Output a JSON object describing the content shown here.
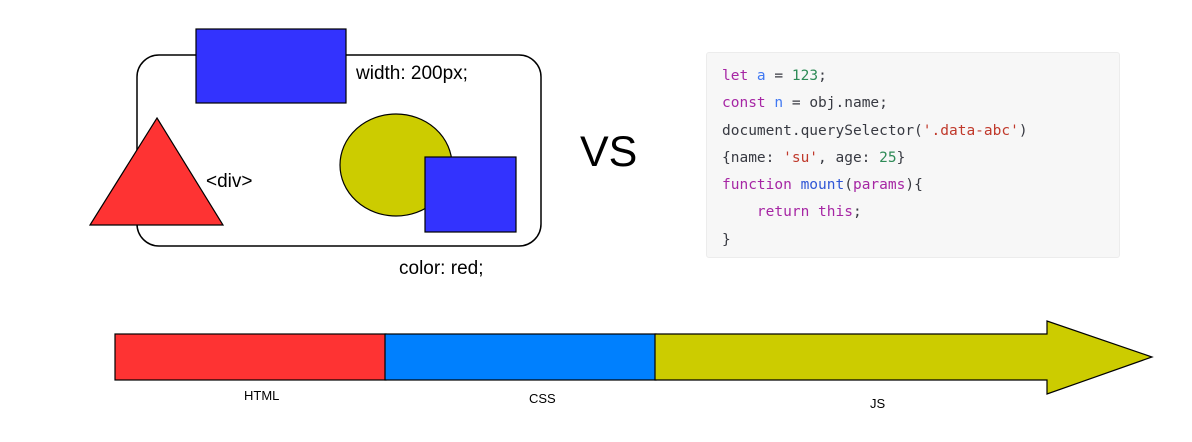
{
  "diagram": {
    "div_tag_label": "<div>",
    "width_label": "width: 200px;",
    "color_label": "color: red;",
    "versus_label": "VS",
    "colors": {
      "red": "#fe3333",
      "blue": "#3333fe",
      "olive": "#cccc00",
      "css_blue": "#0080fe",
      "outline": "#000000"
    }
  },
  "code_panel": {
    "background": "#f7f7f7",
    "lines": [
      [
        {
          "t": "let ",
          "c": "kw"
        },
        {
          "t": "a",
          "c": "var"
        },
        {
          "t": " = ",
          "c": "pl"
        },
        {
          "t": "123",
          "c": "num"
        },
        {
          "t": ";",
          "c": "pl"
        }
      ],
      [
        {
          "t": "const ",
          "c": "kw"
        },
        {
          "t": "n",
          "c": "var"
        },
        {
          "t": " = obj.name;",
          "c": "pl"
        }
      ],
      [
        {
          "t": "document.querySelector(",
          "c": "pl"
        },
        {
          "t": "'.data-abc'",
          "c": "str"
        },
        {
          "t": ")",
          "c": "pl"
        }
      ],
      [
        {
          "t": "{name: ",
          "c": "pl"
        },
        {
          "t": "'su'",
          "c": "str"
        },
        {
          "t": ", age: ",
          "c": "pl"
        },
        {
          "t": "25",
          "c": "num"
        },
        {
          "t": "}",
          "c": "pl"
        }
      ],
      [
        {
          "t": "function ",
          "c": "kw"
        },
        {
          "t": "mount",
          "c": "fn"
        },
        {
          "t": "(",
          "c": "pl"
        },
        {
          "t": "params",
          "c": "kw"
        },
        {
          "t": "){",
          "c": "pl"
        }
      ],
      [
        {
          "t": "    ",
          "c": "pl"
        },
        {
          "t": "return this",
          "c": "kw"
        },
        {
          "t": ";",
          "c": "pl"
        }
      ],
      [
        {
          "t": "}",
          "c": "pl"
        }
      ]
    ]
  },
  "progression": {
    "segments": [
      {
        "label": "HTML",
        "color": "#fe3333"
      },
      {
        "label": "CSS",
        "color": "#0080fe"
      },
      {
        "label": "JS",
        "color": "#cccc00"
      }
    ]
  }
}
